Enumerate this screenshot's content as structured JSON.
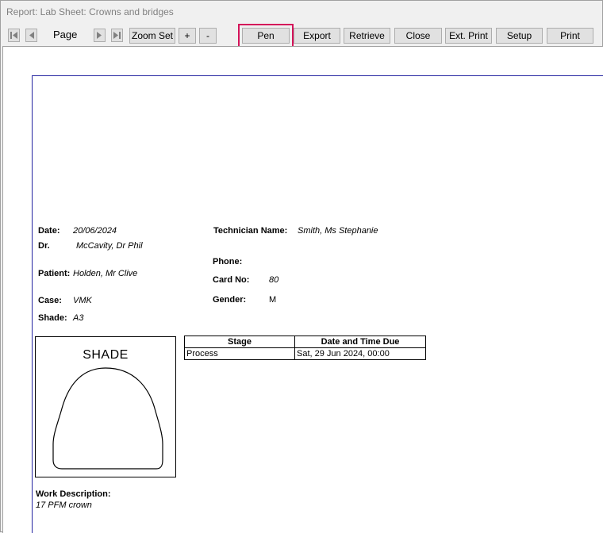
{
  "window": {
    "title": "Report: Lab Sheet: Crowns and bridges"
  },
  "toolbar": {
    "page_label": "Page",
    "zoom_set": "Zoom Set",
    "zoom_in": "+",
    "zoom_out": "-",
    "pen": "Pen",
    "export": "Export",
    "retrieve": "Retrieve",
    "close": "Close",
    "ext_print": "Ext. Print",
    "setup": "Setup",
    "print": "Print"
  },
  "report": {
    "date_label": "Date:",
    "date_value": "20/06/2024",
    "dr_label": "Dr.",
    "dr_value": "McCavity, Dr Phil",
    "patient_label": "Patient:",
    "patient_value": "Holden, Mr Clive",
    "case_label": "Case:",
    "case_value": "VMK",
    "shade_label": "Shade:",
    "shade_value": "A3",
    "tech_label": "Technician Name:",
    "tech_value": "Smith, Ms Stephanie",
    "phone_label": "Phone:",
    "card_label": "Card No:",
    "card_value": "80",
    "gender_label": "Gender:",
    "gender_value": "M",
    "shade_box_title": "SHADE",
    "stages_table": {
      "headers": [
        "Stage",
        "Date and Time Due"
      ],
      "rows": [
        [
          "Process",
          "Sat, 29 Jun 2024, 00:00"
        ]
      ]
    },
    "work_desc_label": "Work Description:",
    "work_desc_value": "17 PFM crown"
  }
}
